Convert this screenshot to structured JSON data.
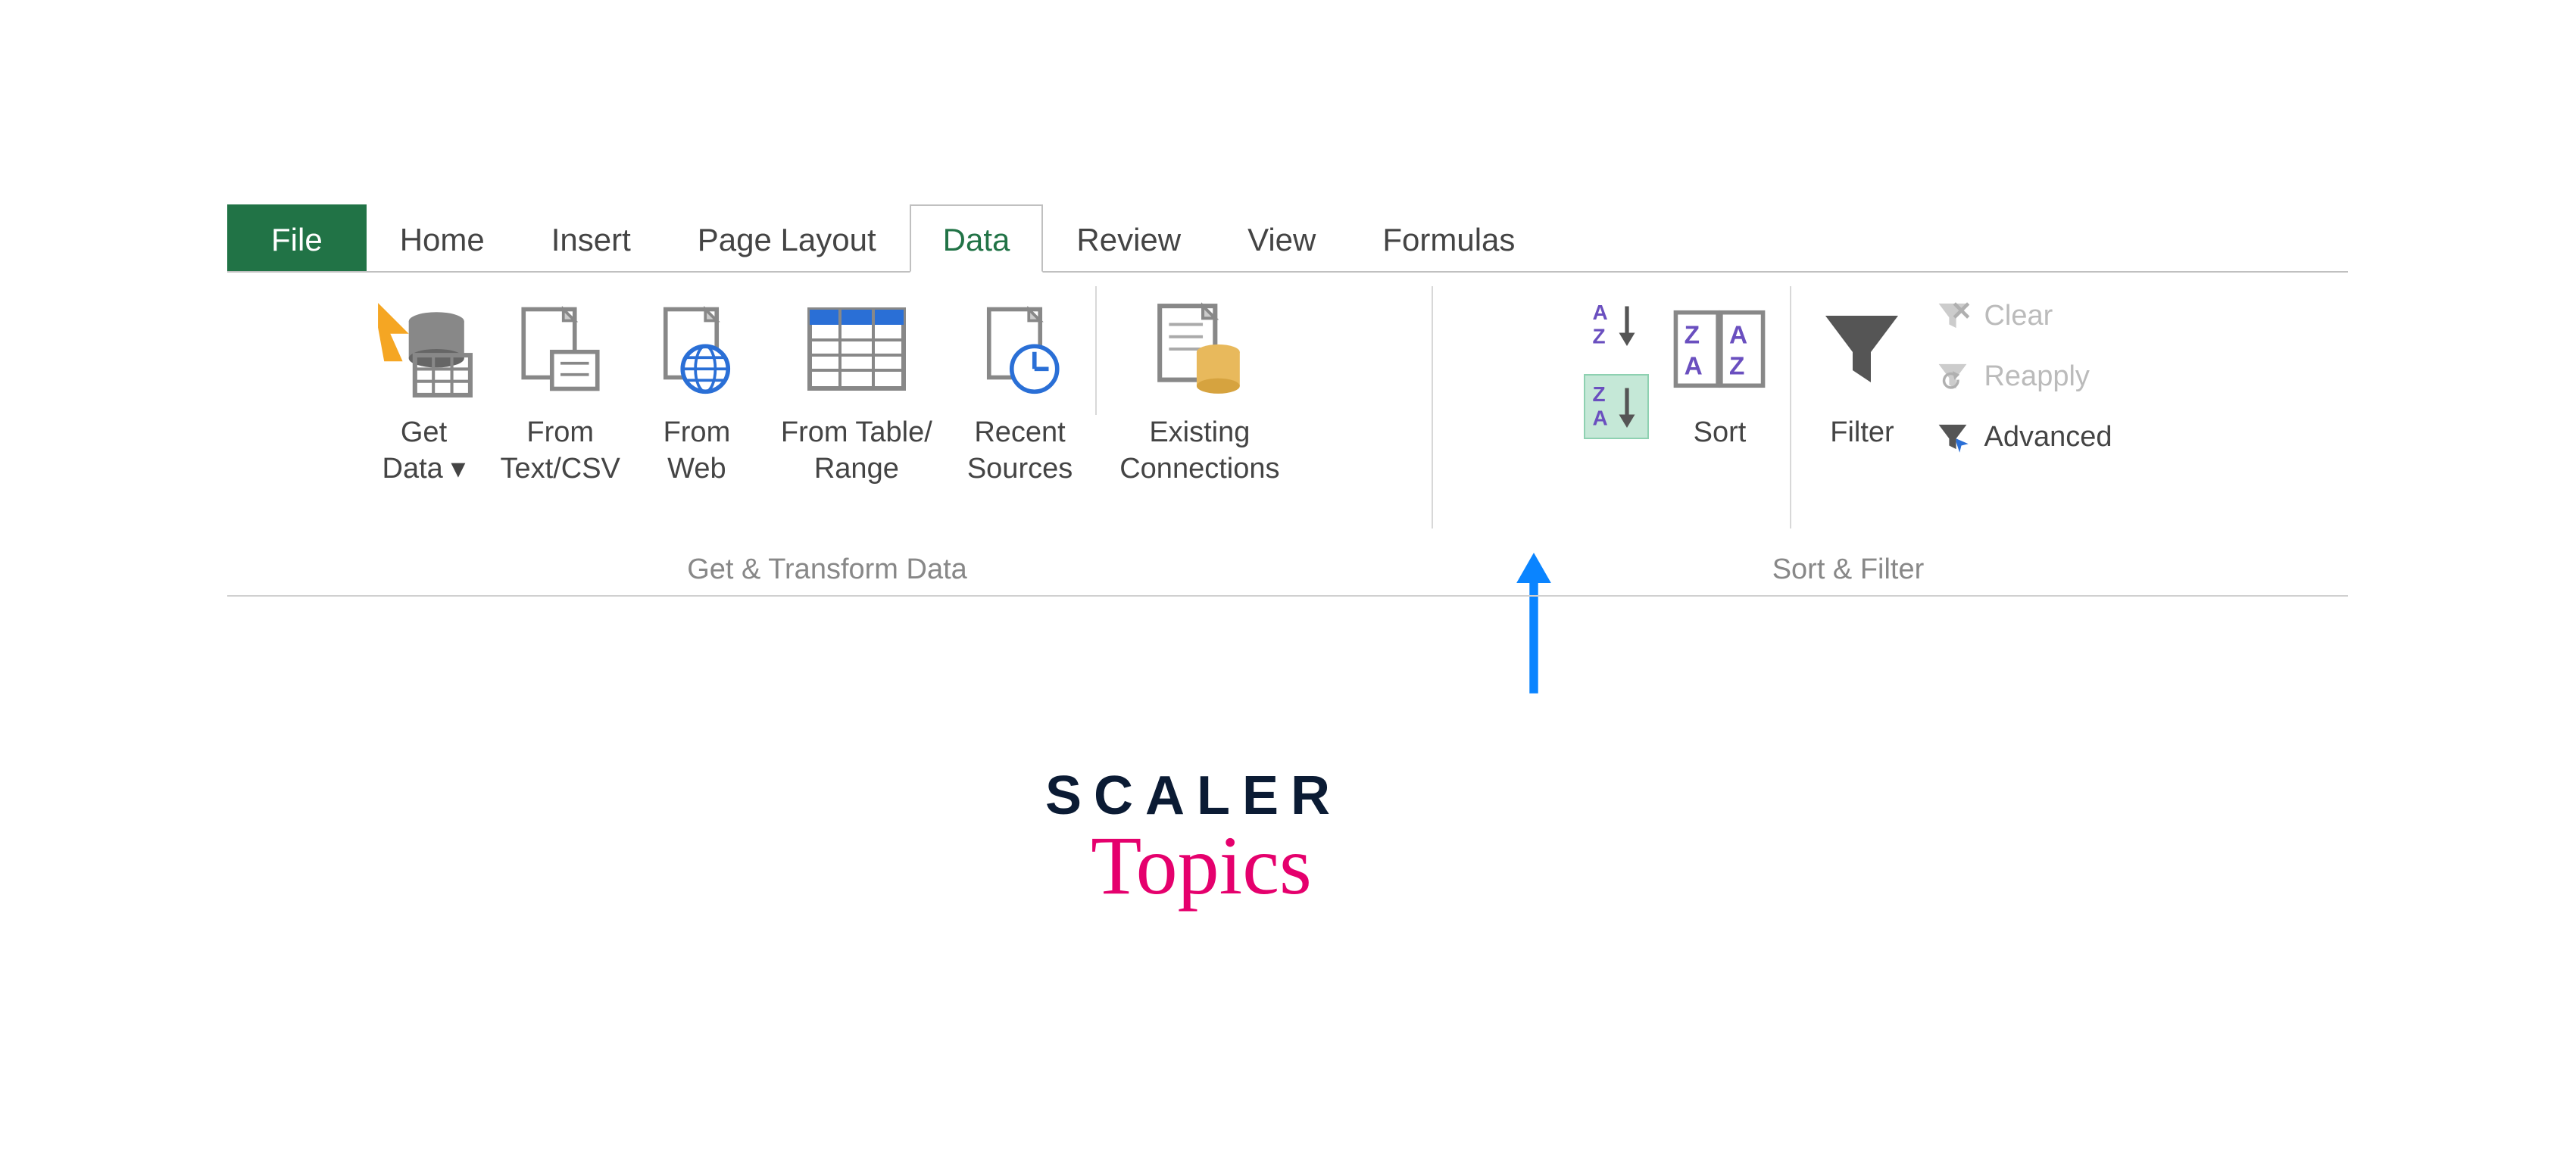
{
  "tabs": {
    "file": "File",
    "home": "Home",
    "insert": "Insert",
    "page_layout": "Page Layout",
    "data": "Data",
    "review": "Review",
    "view": "View",
    "formulas": "Formulas",
    "active": "Data"
  },
  "groups": {
    "get_transform": {
      "label": "Get & Transform Data",
      "get_data": "Get\nData ▾",
      "from_text_csv": "From\nText/CSV",
      "from_web": "From\nWeb",
      "from_table_range": "From Table/\nRange",
      "recent_sources": "Recent\nSources",
      "existing_connections": "Existing\nConnections"
    },
    "sort_filter": {
      "label": "Sort & Filter",
      "sort_asc": "A→Z",
      "sort_desc": "Z→A",
      "sort": "Sort",
      "filter": "Filter",
      "clear": "Clear",
      "reapply": "Reapply",
      "advanced": "Advanced"
    }
  },
  "logo": {
    "line1": "SCALER",
    "line2": "Topics"
  },
  "colors": {
    "excel_green": "#217346",
    "highlight_bg": "#c5e8d7",
    "accent_blue": "#0a84ff",
    "scaler_navy": "#0b1b34",
    "scaler_pink": "#e5006d"
  }
}
